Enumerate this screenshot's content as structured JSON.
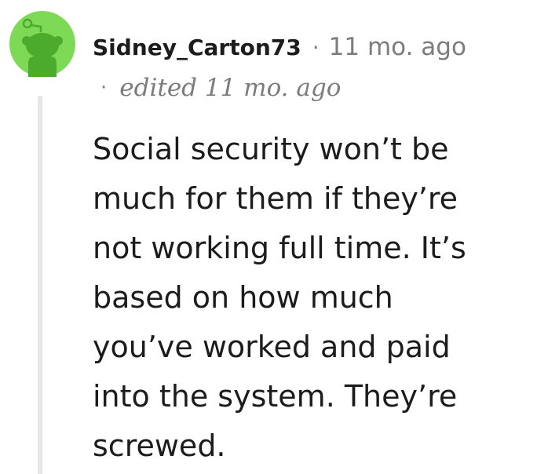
{
  "comment": {
    "username": "Sidney_Carton73",
    "separator": "·",
    "timestamp": "11 mo. ago",
    "edited": "edited 11 mo. ago",
    "body_lines": [
      "Social security won’t be",
      "much for them if they’re",
      "not working full time. It’s",
      "based on how much",
      "you’ve worked and paid",
      "into the system. They’re",
      "screwed."
    ]
  },
  "colors": {
    "avatar_bg": "#7ed957",
    "avatar_figure": "#4caa2c",
    "text_primary": "#1c1c1c",
    "text_meta": "#7c7c7c",
    "thread_line": "#e6e6e6"
  },
  "icons": {
    "avatar": "reddit-snoo-avatar-icon"
  }
}
